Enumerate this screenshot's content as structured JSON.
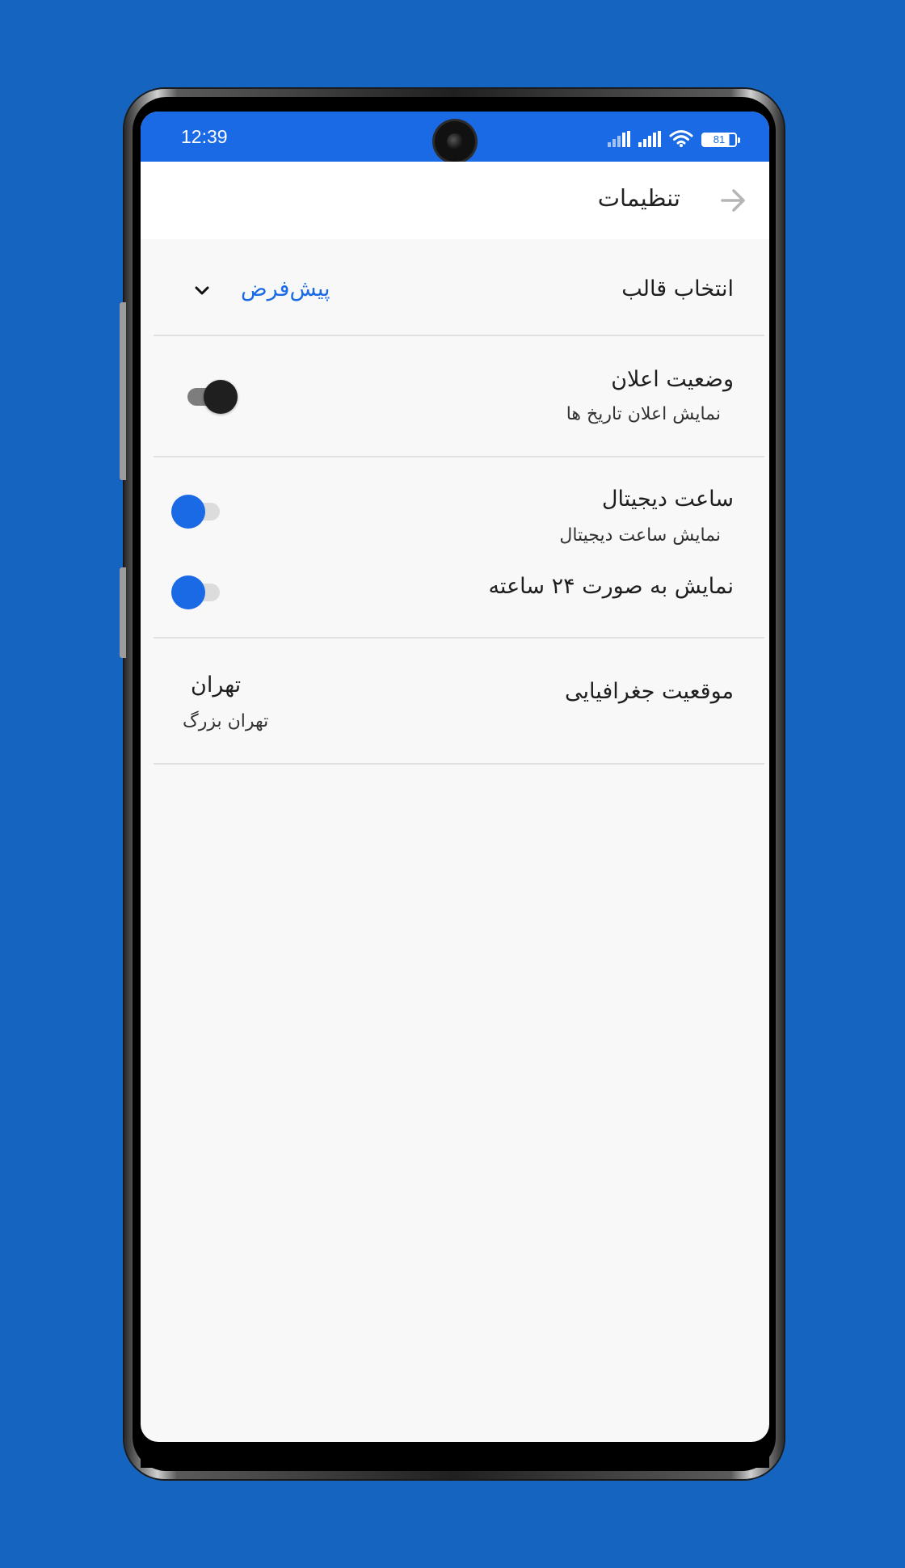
{
  "status_bar": {
    "time": "12:39",
    "battery": "81",
    "icons": [
      "signal-icon",
      "signal-icon",
      "wifi-icon",
      "battery-icon"
    ]
  },
  "app_bar": {
    "title": "تنظیمات",
    "back_icon": "arrow-back-icon"
  },
  "settings": {
    "theme": {
      "label": "انتخاب قالب",
      "value": "پیش‌فرض",
      "icon": "chevron-down-icon"
    },
    "notification": {
      "label": "وضعیت اعلان",
      "description": "نمایش اعلان تاریخ ها",
      "enabled": true
    },
    "digital_clock": {
      "label": "ساعت دیجیتال",
      "description": "نمایش ساعت دیجیتال",
      "enabled": false
    },
    "clock_24h": {
      "label": "نمایش به صورت ۲۴ ساعته",
      "enabled": false
    },
    "location": {
      "label": "موقعیت جغرافیایی",
      "city": "تهران",
      "region": "تهران بزرگ"
    }
  },
  "colors": {
    "background": "#1565c0",
    "accent": "#1a6ae6",
    "screen": "#f8f8f8"
  }
}
